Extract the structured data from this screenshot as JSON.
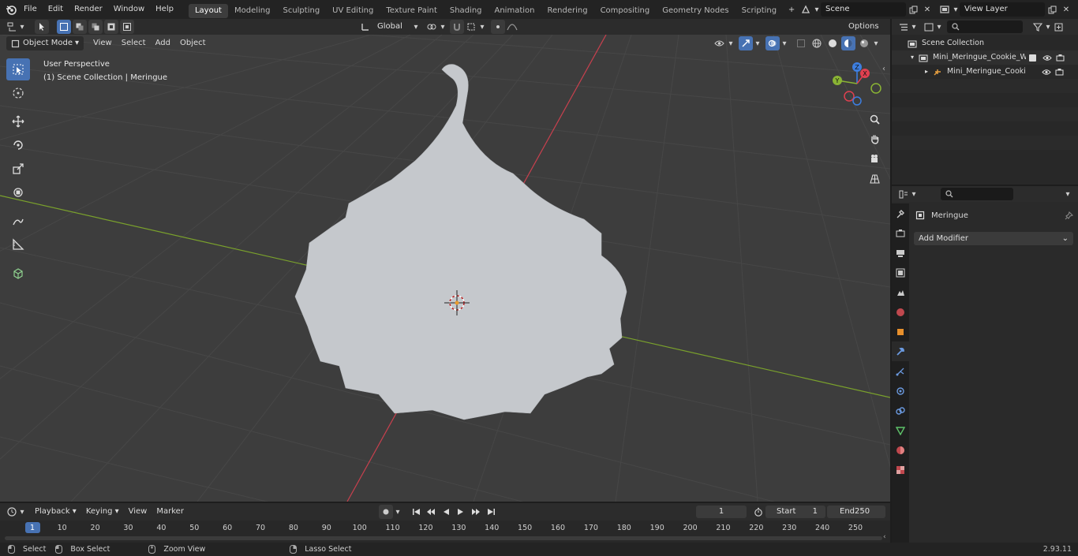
{
  "topbar": {
    "menus": [
      "File",
      "Edit",
      "Render",
      "Window",
      "Help"
    ],
    "workspaces": [
      "Layout",
      "Modeling",
      "Sculpting",
      "UV Editing",
      "Texture Paint",
      "Shading",
      "Animation",
      "Rendering",
      "Compositing",
      "Geometry Nodes",
      "Scripting"
    ],
    "active_workspace": "Layout",
    "add_tab": "+",
    "scene_name": "Scene",
    "view_layer_name": "View Layer"
  },
  "viewport_header": {
    "mode": "Object Mode",
    "menus": [
      "View",
      "Select",
      "Add",
      "Object"
    ],
    "transform_orientation": "Global",
    "options_label": "Options"
  },
  "viewport": {
    "view_name": "User Perspective",
    "collection_info": "(1) Scene Collection | Meringue",
    "gizmo_axes": {
      "x": "X",
      "y": "Y",
      "z": "Z"
    },
    "colors": {
      "background": "#3d3d3d",
      "grid": "#4a4a4a",
      "x_axis": "#c8404e",
      "y_axis": "#7aa12c",
      "mesh": "#c5c8cc"
    }
  },
  "outliner": {
    "root": "Scene Collection",
    "collection": "Mini_Meringue_Cookie_White",
    "object": "Mini_Meringue_Cookie_W"
  },
  "properties": {
    "object_name": "Meringue",
    "add_modifier_label": "Add Modifier"
  },
  "timeline": {
    "menus": [
      "Playback",
      "Keying",
      "View",
      "Marker"
    ],
    "current_frame": "1",
    "start_label": "Start",
    "start_value": "1",
    "end_label": "End",
    "end_value": "250",
    "ticks": [
      "1",
      "10",
      "20",
      "30",
      "40",
      "50",
      "60",
      "70",
      "80",
      "90",
      "100",
      "110",
      "120",
      "130",
      "140",
      "150",
      "160",
      "170",
      "180",
      "190",
      "200",
      "210",
      "220",
      "230",
      "240",
      "250"
    ]
  },
  "statusbar": {
    "select": "Select",
    "box_select": "Box Select",
    "zoom_view": "Zoom View",
    "lasso_select": "Lasso Select",
    "version": "2.93.11"
  }
}
